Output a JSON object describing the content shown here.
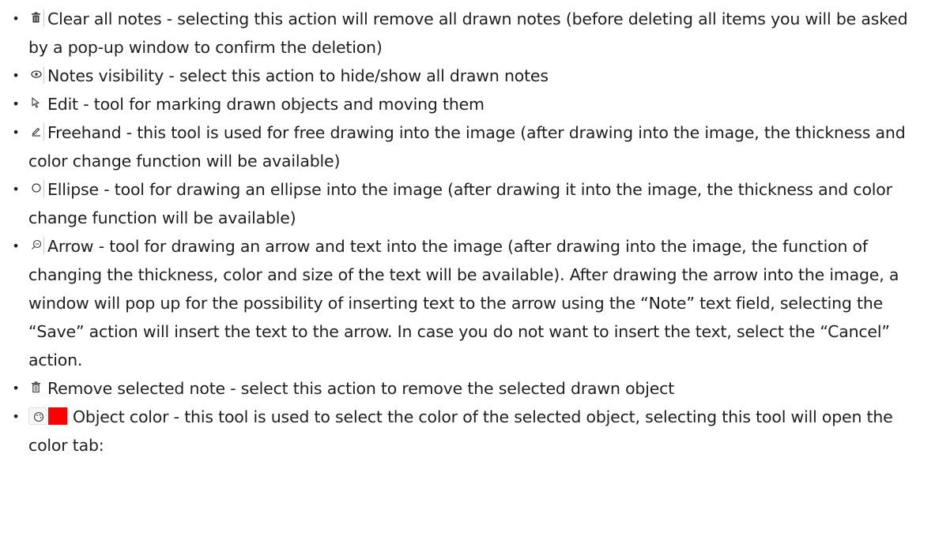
{
  "colors": {
    "text": "#1f1f1f",
    "object_color_swatch": "#ff0000"
  },
  "items": [
    {
      "icon": "trash-icon",
      "text": "Clear all notes - selecting this action will remove all drawn notes (before deleting all items you will be asked by a pop-up window to confirm the deletion)"
    },
    {
      "icon": "eye-icon",
      "text": "Notes visibility - select this action to hide/show all drawn notes"
    },
    {
      "icon": "cursor-arrow-icon",
      "text": "Edit - tool for marking drawn objects and moving them"
    },
    {
      "icon": "pencil-icon",
      "text": "Freehand - this tool is used for free drawing into the image (after drawing into the image, the thickness and color change function will be available)"
    },
    {
      "icon": "ellipse-icon",
      "text": "Ellipse - tool for drawing an ellipse into the image (after drawing it into the image, the thickness and color change function will be available)"
    },
    {
      "icon": "arrow-note-icon",
      "text": "Arrow - tool for drawing an arrow and text into the image (after drawing into the image, the function of changing the thickness, color and size of the text will be available). After drawing the arrow into the image, a window will pop up for the possibility of inserting text to the arrow using the “Note” text field, selecting the “Save” action will insert the text to the arrow. In case you do not want to insert the text, select the “Cancel” action."
    },
    {
      "icon": "trash-outline-icon",
      "text": "Remove selected note - select this action to remove the selected drawn object"
    },
    {
      "icon": "palette-icon",
      "text": "Object color - this tool is used to select the color of the selected object, selecting this tool will open the color tab:"
    }
  ]
}
